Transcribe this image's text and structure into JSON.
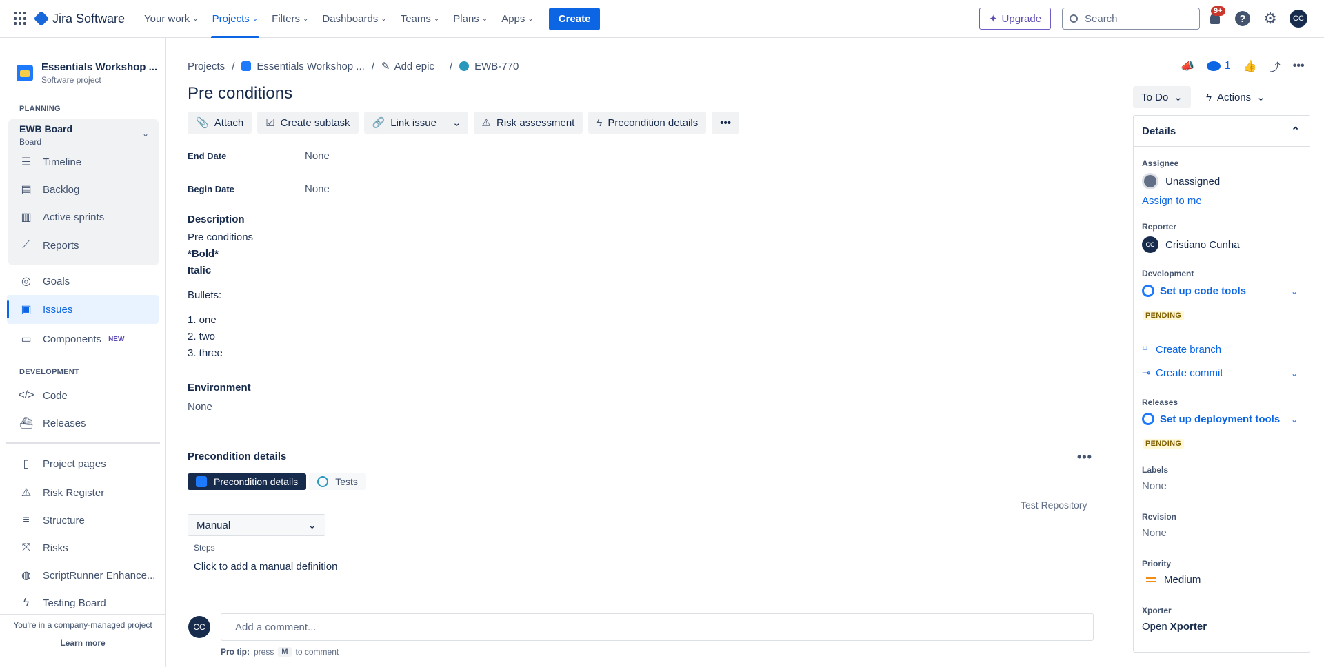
{
  "topnav": {
    "product": "Jira Software",
    "items": [
      {
        "label": "Your work"
      },
      {
        "label": "Projects"
      },
      {
        "label": "Filters"
      },
      {
        "label": "Dashboards"
      },
      {
        "label": "Teams"
      },
      {
        "label": "Plans"
      },
      {
        "label": "Apps"
      }
    ],
    "create": "Create",
    "upgrade": "Upgrade",
    "search_placeholder": "Search",
    "notifications": "9+",
    "user_initials": "CC"
  },
  "sidebar": {
    "project_name": "Essentials Workshop ...",
    "project_type": "Software project",
    "planning_label": "PLANNING",
    "board_title": "EWB Board",
    "board_sub": "Board",
    "board_items": [
      "Timeline",
      "Backlog",
      "Active sprints",
      "Reports"
    ],
    "goals": "Goals",
    "issues": "Issues",
    "components": "Components",
    "new_badge": "NEW",
    "development_label": "DEVELOPMENT",
    "code": "Code",
    "releases": "Releases",
    "extra_items": [
      "Project pages",
      "Risk Register",
      "Structure",
      "Risks",
      "ScriptRunner Enhance...",
      "Testing Board"
    ],
    "footer_text": "You're in a company-managed project",
    "learn_more": "Learn more"
  },
  "breadcrumb": {
    "projects": "Projects",
    "project": "Essentials Workshop ...",
    "add_epic": "Add epic",
    "issue_key": "EWB-770"
  },
  "issue": {
    "title": "Pre conditions",
    "watchers": "1",
    "toolbar": {
      "attach": "Attach",
      "create_subtask": "Create subtask",
      "link_issue": "Link issue",
      "risk_assessment": "Risk assessment",
      "precondition_details": "Precondition details"
    },
    "end_date_label": "End Date",
    "end_date_value": "None",
    "begin_date_label": "Begin Date",
    "begin_date_value": "None",
    "description_label": "Description",
    "description_lines": [
      "Pre conditions",
      "*Bold*",
      "Italic",
      "Bullets:",
      "1. one",
      "2. two",
      "3. three"
    ],
    "environment_label": "Environment",
    "environment_value": "None",
    "precondition_section": "Precondition details",
    "tab_precondition": "Precondition details",
    "tab_tests": "Tests",
    "test_repository": "Test Repository",
    "type_select": "Manual",
    "steps_label": "Steps",
    "steps_add": "Click to add a manual definition",
    "comment_placeholder": "Add a comment...",
    "protip_prefix": "Pro tip:",
    "protip_press": "press",
    "protip_key": "M",
    "protip_suffix": "to comment"
  },
  "details": {
    "status": "To Do",
    "actions": "Actions",
    "header": "Details",
    "assignee_label": "Assignee",
    "assignee": "Unassigned",
    "assign_to_me": "Assign to me",
    "reporter_label": "Reporter",
    "reporter": "Cristiano Cunha",
    "reporter_initials": "CC",
    "development_label": "Development",
    "setup_code_tools": "Set up code tools",
    "pending": "PENDING",
    "create_branch": "Create branch",
    "create_commit": "Create commit",
    "releases_label": "Releases",
    "setup_deploy_tools": "Set up deployment tools",
    "labels_label": "Labels",
    "labels_value": "None",
    "revision_label": "Revision",
    "revision_value": "None",
    "priority_label": "Priority",
    "priority_value": "Medium",
    "xporter_label": "Xporter",
    "xporter_open": "Open",
    "xporter_name": "Xporter"
  }
}
